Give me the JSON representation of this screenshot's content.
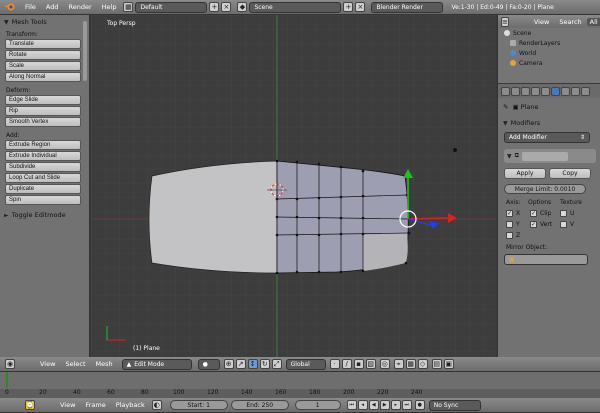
{
  "topbar": {
    "menus": [
      "File",
      "Add",
      "Render",
      "Help"
    ],
    "layout": "Default",
    "scene": "Scene",
    "engine": "Blender Render",
    "stats": "Ve:1-30 | Ed:0-49 | Fa:0-20 | Plane"
  },
  "toolshelf": {
    "title": "Mesh Tools",
    "transform_label": "Transform:",
    "transform": [
      "Translate",
      "Rotate",
      "Scale",
      "Along Normal"
    ],
    "deform_label": "Deform:",
    "deform": [
      "Edge Slide",
      "Rip",
      "Smooth Vertex"
    ],
    "add_label": "Add:",
    "add": [
      "Extrude Region",
      "Extrude Individual",
      "Subdivide",
      "Loop Cut and Slide",
      "Duplicate",
      "Spin"
    ],
    "toggle": "Toggle Editmode"
  },
  "viewport": {
    "view_name": "Top Persp",
    "object_label": "(1) Plane"
  },
  "outliner": {
    "view": "View",
    "search": "Search",
    "all": "All",
    "items": [
      "Scene",
      "RenderLayers",
      "World",
      "Camera"
    ]
  },
  "properties": {
    "object": "Plane",
    "panel": "Modifiers",
    "add_modifier": "Add Modifier",
    "apply": "Apply",
    "copy": "Copy",
    "merge_limit": "Merge Limit: 0.0010",
    "axis": "Axis:",
    "options": "Options",
    "texture": "Texture",
    "x": "X",
    "y": "Y",
    "z": "Z",
    "clip": "Clip",
    "vert": "Vert",
    "u": "U",
    "v": "V",
    "mirror_object": "Mirror Object:"
  },
  "vp_header": {
    "menus": [
      "View",
      "Select",
      "Mesh"
    ],
    "mode": "Edit Mode",
    "orientation": "Global"
  },
  "timeline": {
    "ticks": [
      "0",
      "20",
      "40",
      "60",
      "80",
      "100",
      "120",
      "140",
      "160",
      "180",
      "200",
      "220",
      "240"
    ],
    "menus": [
      "View",
      "Frame",
      "Playback"
    ],
    "start": "Start: 1",
    "end": "End: 250",
    "current": "1",
    "sync": "No Sync"
  },
  "colors": {
    "selected_face": "#9e9eb2",
    "x_axis": "#e02020",
    "y_axis": "#20c020",
    "z_axis": "#2040e0"
  }
}
